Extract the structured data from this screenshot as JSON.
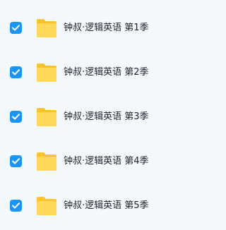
{
  "files": [
    {
      "name": "钟叔·逻辑英语 第1季",
      "checked": true,
      "icon": "folder-icon"
    },
    {
      "name": "钟叔·逻辑英语 第2季",
      "checked": true,
      "icon": "folder-icon"
    },
    {
      "name": "钟叔·逻辑英语 第3季",
      "checked": true,
      "icon": "folder-icon"
    },
    {
      "name": "钟叔·逻辑英语 第4季",
      "checked": true,
      "icon": "folder-icon"
    },
    {
      "name": "钟叔·逻辑英语 第5季",
      "checked": true,
      "icon": "folder-icon"
    }
  ],
  "colors": {
    "background": "#f3f8fd",
    "checkbox": "#1a94f6",
    "folder_back": "#f9c22e",
    "folder_front": "#ffd85a",
    "text": "#1f2329"
  }
}
